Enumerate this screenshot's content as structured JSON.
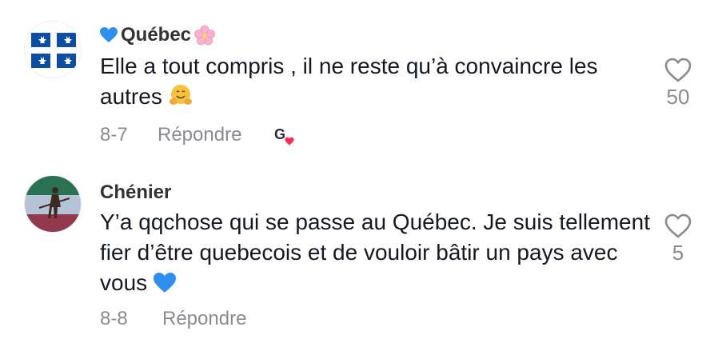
{
  "comments": [
    {
      "username": "Québec",
      "username_prefix_icon": "blue-heart-icon",
      "username_suffix_icon": "cherry-blossom-icon",
      "text": "Elle a tout compris , il ne reste qu’à convaincre les autres",
      "text_emoji": "hugging-face-icon",
      "date": "8-7",
      "reply_label": "Répondre",
      "liked_by_creator": true,
      "like_count": "50",
      "avatar": "quebec-flag-avatar"
    },
    {
      "username": "Chénier",
      "text": "Y’a qqchose qui se passe au Québec. Je suis tellement fier d’être quebecois et de vouloir bâtir un pays avec vous",
      "text_emoji": "blue-heart-icon",
      "date": "8-8",
      "reply_label": "Répondre",
      "liked_by_creator": false,
      "like_count": "5",
      "avatar": "patriot-flag-avatar"
    }
  ],
  "colors": {
    "text": "#161823",
    "username": "#333333",
    "meta": "#8a8b91",
    "quebec_blue": "#0b4ea2",
    "creator_heart": "#fe2c55"
  }
}
